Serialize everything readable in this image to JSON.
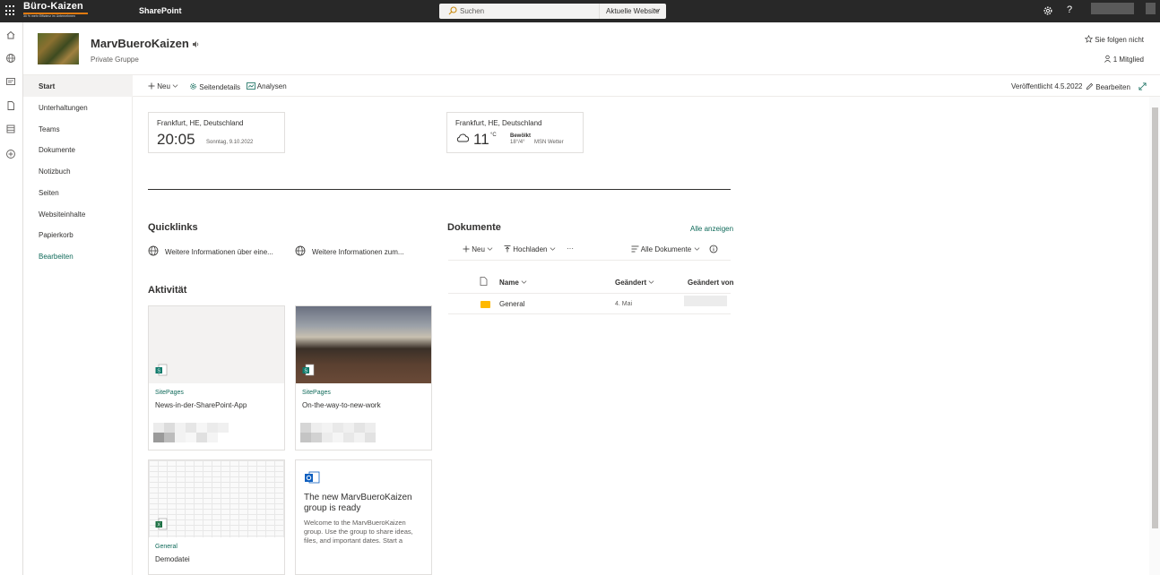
{
  "topbar": {
    "logo_name": "Büro-Kaizen",
    "logo_tagline": "30 % mehr Effizienz im Unternehmen",
    "app_name": "SharePoint",
    "search_placeholder": "Suchen",
    "search_scope": "Aktuelle Website",
    "help_label": "?"
  },
  "site": {
    "title": "MarvBueroKaizen",
    "subtitle": "Private Gruppe",
    "follow_label": "Sie folgen nicht",
    "members_label": "1 Mitglied"
  },
  "nav": {
    "items": [
      "Start",
      "Unterhaltungen",
      "Teams",
      "Dokumente",
      "Notizbuch",
      "Seiten",
      "Websiteinhalte",
      "Papierkorb"
    ],
    "edit_label": "Bearbeiten"
  },
  "commandbar": {
    "new_label": "Neu",
    "page_details_label": "Seitendetails",
    "analytics_label": "Analysen",
    "published_label": "Veröffentlicht 4.5.2022",
    "edit_label": "Bearbeiten"
  },
  "clock": {
    "location": "Frankfurt, HE, Deutschland",
    "time": "20:05",
    "date": "Sonntag, 9.10.2022"
  },
  "weather": {
    "location": "Frankfurt, HE, Deutschland",
    "temp": "11",
    "unit": "°C",
    "condition": "Bewölkt",
    "range": "18°/4°",
    "source": "MSN Wetter"
  },
  "quicklinks": {
    "title": "Quicklinks",
    "items": [
      "Weitere Informationen über eine...",
      "Weitere Informationen zum..."
    ]
  },
  "documents": {
    "title": "Dokumente",
    "see_all": "Alle anzeigen",
    "new_label": "Neu",
    "upload_label": "Hochladen",
    "more_label": "···",
    "view_label": "Alle Dokumente",
    "columns": [
      "Name",
      "Geändert",
      "Geändert von"
    ],
    "rows": [
      {
        "name": "General",
        "modified": "4. Mai"
      }
    ]
  },
  "activity": {
    "title": "Aktivität",
    "cards": [
      {
        "kind": "SitePages",
        "name": "News-in-der-SharePoint-App"
      },
      {
        "kind": "SitePages",
        "name": "On-the-way-to-new-work"
      },
      {
        "kind": "General",
        "name": "Demodatei"
      }
    ],
    "announcement": {
      "title": "The new MarvBueroKaizen group is ready",
      "text": "Welcome to the MarvBueroKaizen group. Use the group to share ideas, files, and important dates. Start a"
    }
  },
  "colors": {
    "suite_bar": "#282828",
    "accent": "#0f6a5a",
    "folder": "#ffb900"
  }
}
